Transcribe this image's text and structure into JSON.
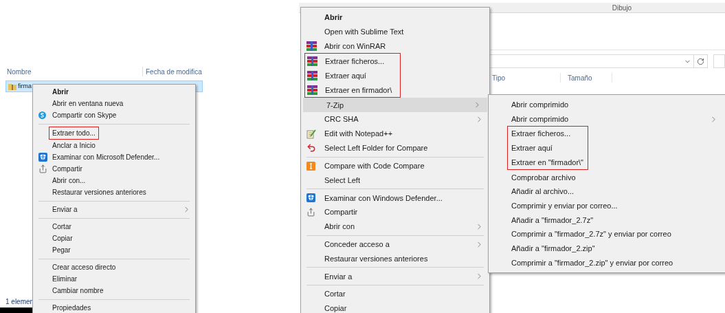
{
  "left": {
    "explorer": {
      "columns": [
        "Nombre",
        "Fecha de modifica"
      ],
      "file": {
        "name": "firma",
        "selected": true
      },
      "status": "1 elemen"
    },
    "menu": [
      {
        "kind": "default",
        "label": "Abrir"
      },
      {
        "kind": "item",
        "label": "Abrir en ventana nueva"
      },
      {
        "kind": "skype",
        "label": "Compartir con Skype"
      },
      {
        "kind": "separator"
      },
      {
        "kind": "group",
        "items": [
          {
            "kind": "item",
            "label": "Extraer todo..."
          }
        ]
      },
      {
        "kind": "item",
        "label": "Anclar a Inicio"
      },
      {
        "kind": "defender",
        "label": "Examinar con Microsoft Defender..."
      },
      {
        "kind": "share",
        "label": "Compartir"
      },
      {
        "kind": "item",
        "label": "Abrir con..."
      },
      {
        "kind": "item",
        "label": "Restaurar versiones anteriores"
      },
      {
        "kind": "separator"
      },
      {
        "kind": "submenu",
        "label": "Enviar a"
      },
      {
        "kind": "separator"
      },
      {
        "kind": "item",
        "label": "Cortar"
      },
      {
        "kind": "item",
        "label": "Copiar"
      },
      {
        "kind": "item",
        "label": "Pegar"
      },
      {
        "kind": "separator"
      },
      {
        "kind": "item",
        "label": "Crear acceso directo"
      },
      {
        "kind": "item",
        "label": "Eliminar"
      },
      {
        "kind": "item",
        "label": "Cambiar nombre"
      },
      {
        "kind": "separator"
      },
      {
        "kind": "item",
        "label": "Propiedades"
      }
    ]
  },
  "right": {
    "window": {
      "title": "Dibujo",
      "columns": [
        "Tipo",
        "Tamaño"
      ]
    },
    "menu": [
      {
        "kind": "default",
        "label": "Abrir",
        "hovered": false
      },
      {
        "kind": "item",
        "label": "Open with Sublime Text",
        "hovered": false
      },
      {
        "kind": "winrar",
        "label": "Abrir con WinRAR",
        "hovered": false
      },
      {
        "kind": "group",
        "items": [
          {
            "kind": "winrar",
            "label": "Extraer ficheros...",
            "hovered": false
          },
          {
            "kind": "winrar",
            "label": "Extraer aquí",
            "hovered": false
          },
          {
            "kind": "winrar",
            "label": "Extraer en firmador\\",
            "hovered": false
          }
        ]
      },
      {
        "kind": "submenu",
        "label": "7-Zip",
        "hovered": true
      },
      {
        "kind": "submenu",
        "label": "CRC SHA",
        "hovered": false
      },
      {
        "kind": "notepad",
        "label": "Edit with Notepad++",
        "hovered": false
      },
      {
        "kind": "undo",
        "label": "Select Left Folder for Compare",
        "hovered": false
      },
      {
        "kind": "separator"
      },
      {
        "kind": "compare",
        "label": "Compare with Code Compare",
        "hovered": false
      },
      {
        "kind": "item",
        "label": "Select Left",
        "hovered": false
      },
      {
        "kind": "separator"
      },
      {
        "kind": "defender",
        "label": "Examinar con Windows Defender...",
        "hovered": false
      },
      {
        "kind": "share",
        "label": "Compartir",
        "hovered": false
      },
      {
        "kind": "submenu",
        "label": "Abrir con",
        "hovered": false
      },
      {
        "kind": "separator"
      },
      {
        "kind": "submenu",
        "label": "Conceder acceso a",
        "hovered": false
      },
      {
        "kind": "item",
        "label": "Restaurar versiones anteriores",
        "hovered": false
      },
      {
        "kind": "separator"
      },
      {
        "kind": "submenu",
        "label": "Enviar a",
        "hovered": false
      },
      {
        "kind": "separator"
      },
      {
        "kind": "item",
        "label": "Cortar",
        "hovered": false
      },
      {
        "kind": "item",
        "label": "Copiar",
        "hovered": false
      }
    ],
    "submenu": [
      {
        "kind": "item",
        "label": "Abrir comprimido"
      },
      {
        "kind": "submenu",
        "label": "Abrir comprimido"
      },
      {
        "kind": "group",
        "items": [
          {
            "kind": "item",
            "label": "Extraer ficheros..."
          },
          {
            "kind": "item",
            "label": "Extraer aquí"
          },
          {
            "kind": "item",
            "label": "Extraer en \"firmador\\\""
          }
        ]
      },
      {
        "kind": "item",
        "label": "Comprobar archivo"
      },
      {
        "kind": "item",
        "label": "Añadir al archivo..."
      },
      {
        "kind": "item",
        "label": "Comprimir y enviar por correo..."
      },
      {
        "kind": "item",
        "label": "Añadir a \"firmador_2.7z\""
      },
      {
        "kind": "item",
        "label": "Comprimir a \"firmador_2.7z\" y enviar por correo"
      },
      {
        "kind": "item",
        "label": "Añadir a \"firmador_2.zip\""
      },
      {
        "kind": "item",
        "label": "Comprimir a \"firmador_2.zip\" y enviar por correo"
      }
    ]
  }
}
